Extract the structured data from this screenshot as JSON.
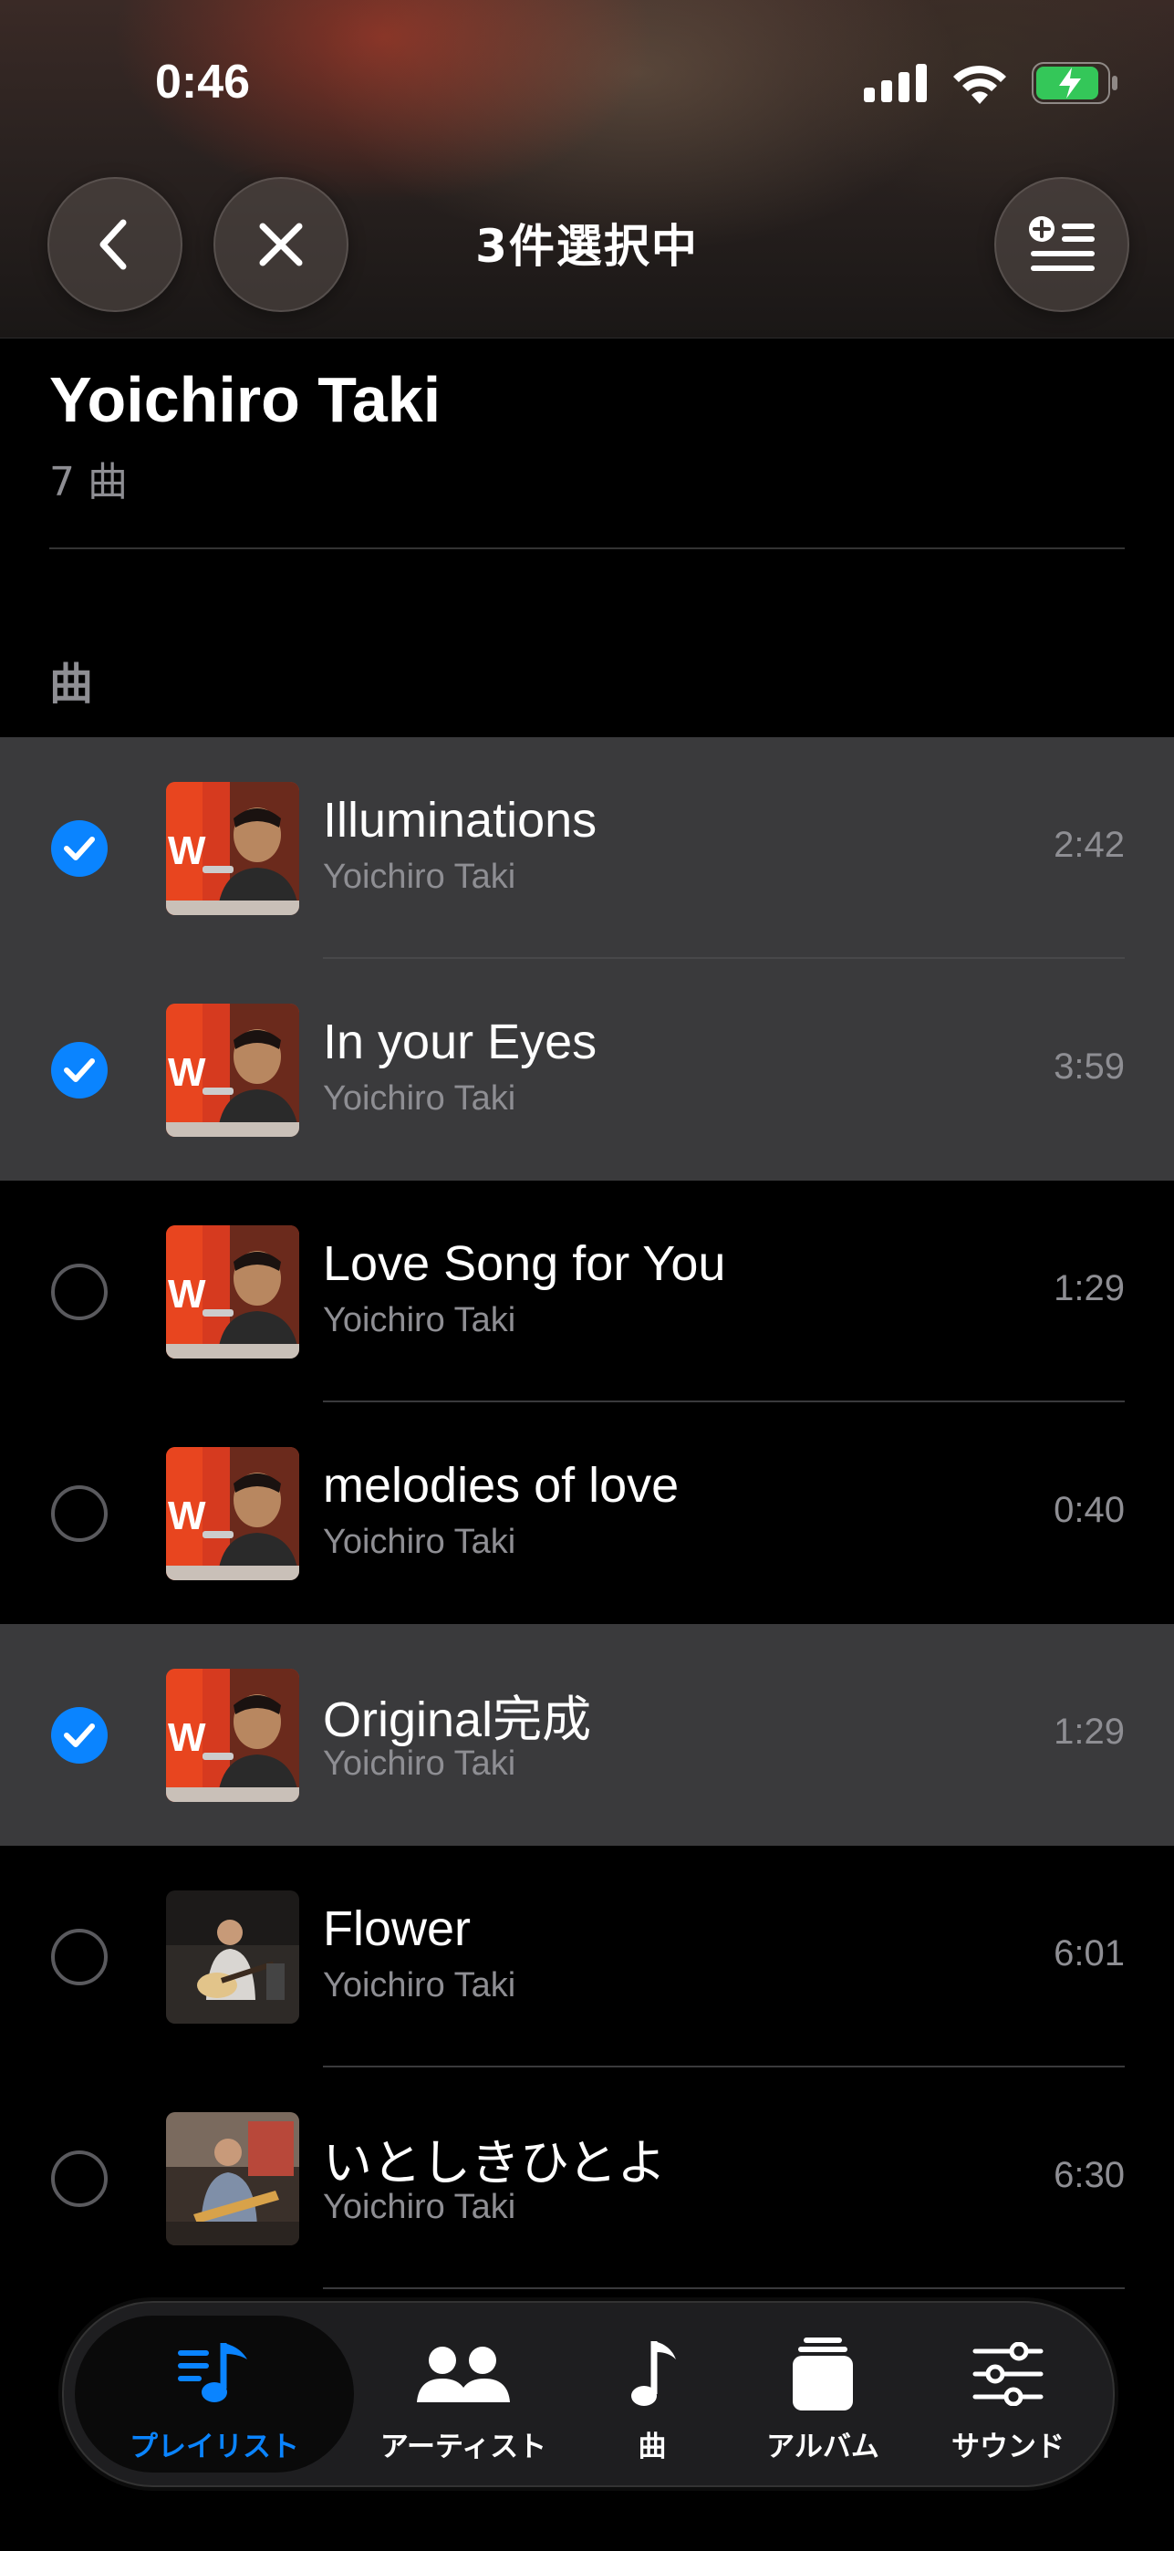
{
  "status_bar": {
    "time": "0:46"
  },
  "nav": {
    "title": "3件選択中"
  },
  "artist": {
    "name": "Yoichiro Taki",
    "song_count": "7 曲"
  },
  "section": {
    "label": "曲"
  },
  "songs": [
    {
      "title": "Illuminations",
      "artist": "Yoichiro Taki",
      "duration": "2:42",
      "selected": true
    },
    {
      "title": "In your Eyes",
      "artist": "Yoichiro Taki",
      "duration": "3:59",
      "selected": true
    },
    {
      "title": "Love Song for You",
      "artist": "Yoichiro Taki",
      "duration": "1:29",
      "selected": false
    },
    {
      "title": "melodies of love",
      "artist": "Yoichiro Taki",
      "duration": "0:40",
      "selected": false
    },
    {
      "title": "Original完成",
      "artist": "Yoichiro Taki",
      "duration": "1:29",
      "selected": true
    },
    {
      "title": "Flower",
      "artist": "Yoichiro Taki",
      "duration": "6:01",
      "selected": false
    },
    {
      "title": "いとしきひとよ",
      "artist": "Yoichiro Taki",
      "duration": "6:30",
      "selected": false
    }
  ],
  "tabs": [
    {
      "label": "プレイリスト",
      "icon": "playlist-icon",
      "active": true
    },
    {
      "label": "アーティスト",
      "icon": "artists-icon",
      "active": false
    },
    {
      "label": "曲",
      "icon": "music-note-icon",
      "active": false
    },
    {
      "label": "アルバム",
      "icon": "album-icon",
      "active": false
    },
    {
      "label": "サウンド",
      "icon": "sliders-icon",
      "active": false
    }
  ],
  "colors": {
    "accent": "#0a84ff",
    "selected_row": "#3a3a3c",
    "secondary_text": "#8e8e93",
    "battery": "#34c759"
  }
}
